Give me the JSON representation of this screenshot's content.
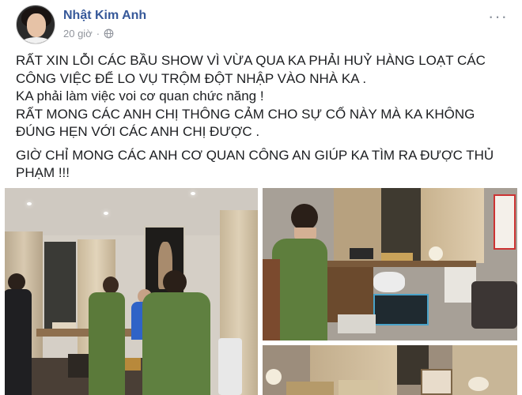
{
  "post": {
    "author": "Nhật Kim Anh",
    "time": "20 giờ",
    "more_label": "···",
    "paragraphs": [
      "RẤT XIN LỖI CÁC BẦU SHOW VÌ VỪA QUA KA PHẢI HUỶ HÀNG LOẠT CÁC CÔNG VIỆC ĐỂ LO VỤ TRỘM ĐỘT NHẬP VÀO NHÀ KA .",
      "KA phải làm việc voi cơ quan chức năng !",
      "RẤT MONG CÁC ANH CHỊ THÔNG CẢM CHO SỰ CỐ NÀY MÀ KA KHÔNG ĐÚNG HẸN VỚI CÁC ANH CHỊ ĐƯỢC .",
      "GIỜ CHỈ MONG CÁC ANH CƠ QUAN CÔNG AN GIÚP KA TÌM RA ĐƯỢC THỦ PHẠM !!!"
    ]
  },
  "icons": {
    "privacy": "globe-icon",
    "menu": "more-options-icon"
  },
  "colors": {
    "author_link": "#365899",
    "meta_text": "#90949c",
    "body_text": "#1c1e21",
    "uniform_green": "#5b7a3a"
  }
}
